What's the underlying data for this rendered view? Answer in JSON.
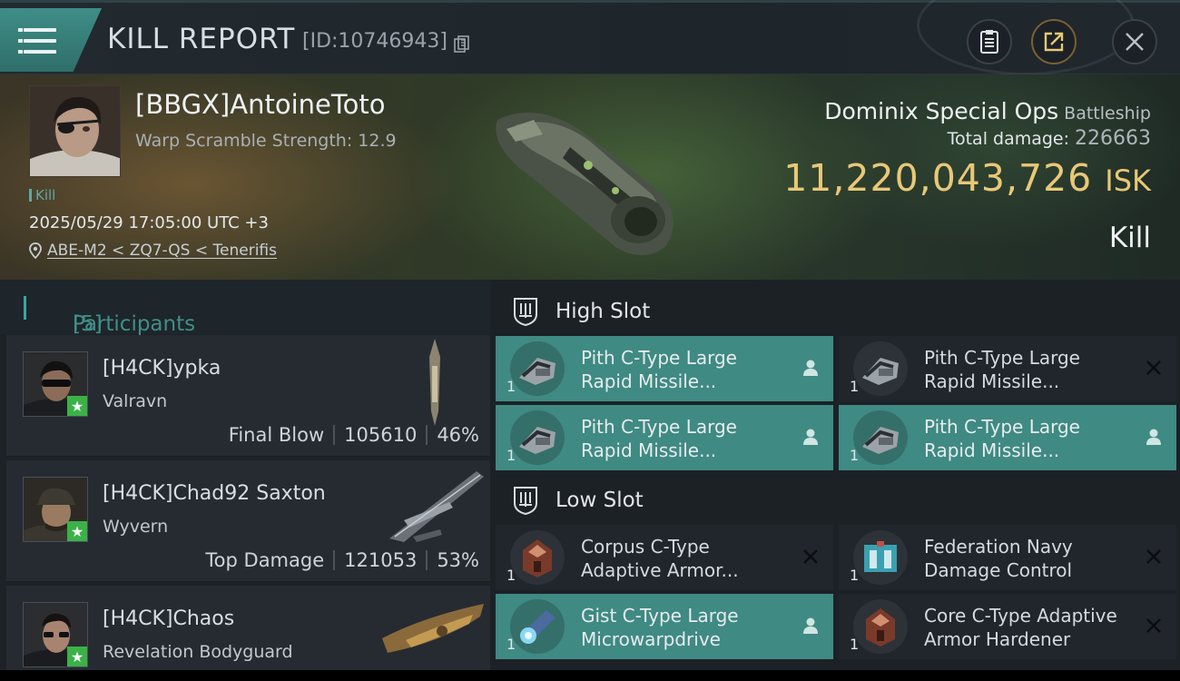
{
  "header": {
    "title": "KILL REPORT",
    "report_id": "[ID:10746943]",
    "icons": [
      "menu-icon",
      "copy-icon",
      "clipboard-icon",
      "share-icon",
      "close-icon"
    ]
  },
  "victim": {
    "name": "[BBGX]AntoineToto",
    "warp_scramble": "Warp Scramble Strength: 12.9",
    "tag": "Kill",
    "datetime": "2025/05/29 17:05:00 UTC +3",
    "location": "ABE-M2 < ZQ7-QS < Tenerifis"
  },
  "ship": {
    "name": "Dominix Special Ops",
    "class": "Battleship",
    "total_damage_label": "Total damage:",
    "total_damage": "226663",
    "value": "11,220,043,726",
    "value_unit": "ISK",
    "result": "Kill"
  },
  "participants": {
    "label": "Participants",
    "count": "[5]",
    "items": [
      {
        "name": "[H4CK]ypka",
        "ship": "Valravn",
        "role": "Final Blow",
        "damage": "105610",
        "percent": "46%"
      },
      {
        "name": "[H4CK]Chad92 Saxton",
        "ship": "Wyvern",
        "role": "Top Damage",
        "damage": "121053",
        "percent": "53%"
      },
      {
        "name": "[H4CK]Chaos",
        "ship": "Revelation Bodyguard"
      }
    ]
  },
  "high_slot": {
    "label": "High Slot",
    "modules": [
      {
        "name1": "Pith C-Type Large",
        "name2": "Rapid Missile...",
        "qty": "1",
        "status": "dropped"
      },
      {
        "name1": "Pith C-Type Large",
        "name2": "Rapid Missile...",
        "qty": "1",
        "status": "destroyed"
      },
      {
        "name1": "Pith C-Type Large",
        "name2": "Rapid Missile...",
        "qty": "1",
        "status": "dropped"
      },
      {
        "name1": "Pith C-Type Large",
        "name2": "Rapid Missile...",
        "qty": "1",
        "status": "dropped"
      }
    ]
  },
  "low_slot": {
    "label": "Low Slot",
    "modules": [
      {
        "name1": "Corpus C-Type",
        "name2": "Adaptive Armor...",
        "qty": "1",
        "status": "destroyed"
      },
      {
        "name1": "Federation Navy",
        "name2": "Damage Control",
        "qty": "1",
        "status": "destroyed"
      },
      {
        "name1": "Gist C-Type Large",
        "name2": "Microwarpdrive",
        "qty": "1",
        "status": "dropped"
      },
      {
        "name1": "Core C-Type Adaptive",
        "name2": " Armor Hardener",
        "qty": "1",
        "status": "destroyed"
      }
    ]
  },
  "colors": {
    "accent": "#3f8a83",
    "isk": "#e8c877",
    "star": "#3bb148"
  }
}
